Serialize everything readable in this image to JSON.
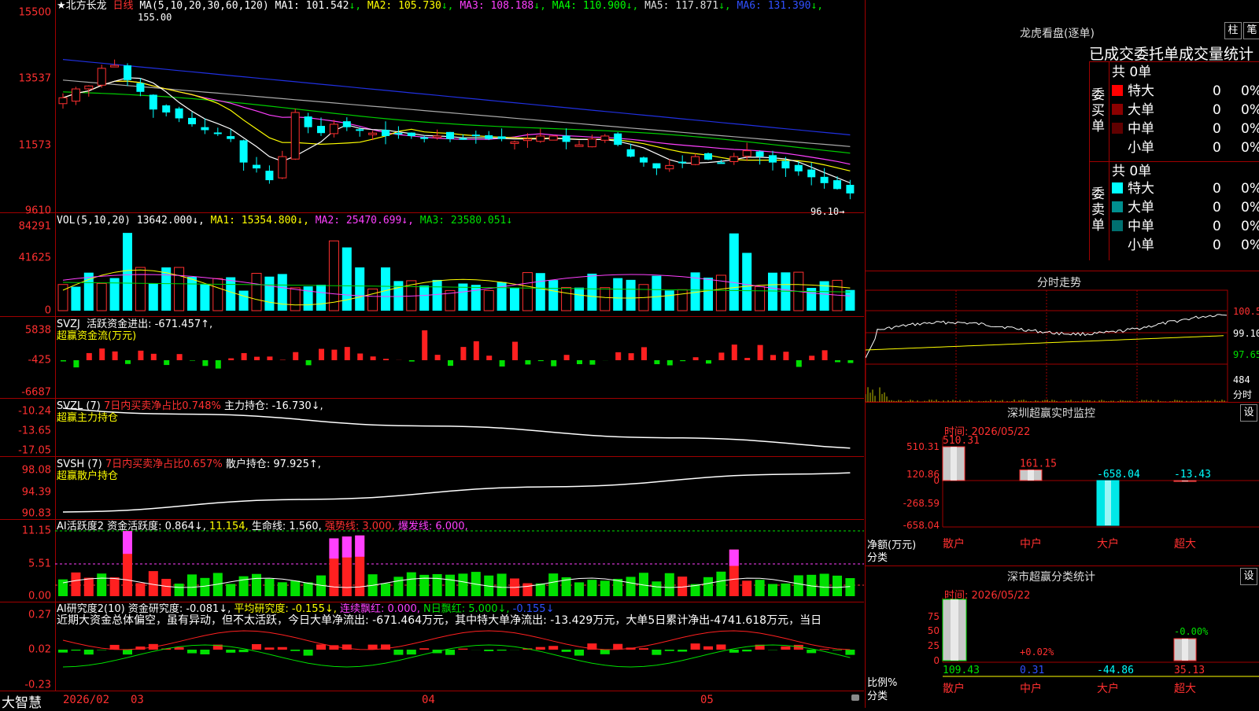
{
  "main": {
    "stock_name": "★北方长龙",
    "period": "日线",
    "ma_label": "MA(5,10,20,30,60,120)",
    "ma": [
      {
        "label": "MA1:",
        "value": "101.542",
        "arrow": "↓",
        "color": "#ffffff"
      },
      {
        "label": "MA2:",
        "value": "105.730",
        "arrow": "↓",
        "color": "#ffff00"
      },
      {
        "label": "MA3:",
        "value": "108.188",
        "arrow": "↓",
        "color": "#ff40ff"
      },
      {
        "label": "MA4:",
        "value": "110.900",
        "arrow": "↓",
        "color": "#00ff00"
      },
      {
        "label": "MA5:",
        "value": "117.871",
        "arrow": "↓",
        "color": "#dddddd"
      },
      {
        "label": "MA6:",
        "value": "131.390",
        "arrow": "↓",
        "color": "#3050ff"
      }
    ],
    "y_labels": [
      "15500",
      "13537",
      "11573",
      "9610"
    ],
    "high_mark": "155.00",
    "low_mark": "96.10→"
  },
  "vol": {
    "label": "VOL(5,10,20)",
    "value": "13642.000↓,",
    "ma1": "MA1: 15354.800↓,",
    "ma2": "MA2: 25470.699↓,",
    "ma3": "MA3: 23580.051↓",
    "y_labels": [
      "84291",
      "41625",
      "0"
    ]
  },
  "svzj": {
    "label": "SVZJ",
    "line": "活跃资金进出: -671.457↑,",
    "sub": "超赢资金流(万元)",
    "y_labels": [
      "5838",
      "-425",
      "-6687"
    ]
  },
  "svzl": {
    "label": "SVZL (7)",
    "t1": "7日内买卖净占比0.748%",
    "t2": "主力持仓: -16.730↓,",
    "sub": "超赢主力持仓",
    "y_labels": [
      "-10.24",
      "-13.65",
      "-17.05"
    ]
  },
  "svsh": {
    "label": "SVSH (7)",
    "t1": "7日内买卖净占比0.657%",
    "t2": "散户持仓: 97.925↑,",
    "sub": "超赢散户持仓",
    "y_labels": [
      "98.08",
      "94.39",
      "90.83"
    ]
  },
  "ai1": {
    "label": "AI活跃度2",
    "t1": "资金活跃度: 0.864↓,",
    "t2": "11.154,",
    "t3": "生命线: 1.560,",
    "t4": "强势线: 3.000,",
    "t5": "爆发线: 6.000,",
    "y_labels": [
      "11.15",
      "5.51",
      "0.00"
    ]
  },
  "ai2": {
    "label": "AI研究度2(10)",
    "t1": "资金研究度: -0.081↓,",
    "t2": "平均研究度: -0.155↓,",
    "t3": "连续飘红: 0.000,",
    "t4": "N日飘红: 5.000↓,",
    "t5": "-0.155↓",
    "desc": "近期大资金总体偏空，虽有异动，但不太活跃，今日大单净流出: -671.464万元，其中特大单净流出: -13.429万元，大单5日累计净出-4741.618万元，当日",
    "y_labels": [
      "0.27",
      "0.02",
      "-0.23"
    ]
  },
  "xaxis": {
    "brand": "大智慧",
    "labels": [
      "2026/02",
      "03",
      "04",
      "05"
    ]
  },
  "lhb": {
    "title": "龙虎看盘(逐单)",
    "btn1": "柱",
    "btn2": "笔",
    "header": "已成交委托单成交量统计",
    "buy_side": "委买单",
    "sell_side": "委卖单",
    "buy_total": "共 0单",
    "sell_total": "共 0单",
    "buy_rows": [
      {
        "name": "特大",
        "count": "0",
        "pct": "0%",
        "color": "#ff0000"
      },
      {
        "name": "大单",
        "count": "0",
        "pct": "0%",
        "color": "#8b0000"
      },
      {
        "name": "中单",
        "count": "0",
        "pct": "0%",
        "color": "#600000"
      },
      {
        "name": "小单",
        "count": "0",
        "pct": "0%",
        "color": "#000000"
      }
    ],
    "sell_rows": [
      {
        "name": "特大",
        "count": "0",
        "pct": "0%",
        "color": "#00ffff"
      },
      {
        "name": "大单",
        "count": "0",
        "pct": "0%",
        "color": "#009090"
      },
      {
        "name": "中单",
        "count": "0",
        "pct": "0%",
        "color": "#007070"
      },
      {
        "name": "小单",
        "count": "0",
        "pct": "0%",
        "color": "#000000"
      }
    ]
  },
  "intraday": {
    "title": "分时走势",
    "y_labels": [
      "100.5",
      "99.10",
      "97.65",
      "484"
    ],
    "vol_label": "分时"
  },
  "monitor": {
    "title": "深圳超赢实时监控",
    "btn": "设",
    "time": "时间: 2026/05/22",
    "y_labels": [
      "510.31",
      "120.86",
      "0",
      "-268.59",
      "-658.04"
    ],
    "values": [
      {
        "cat": "散户",
        "value": "510.31",
        "num": 510.31,
        "color": "#ff3030"
      },
      {
        "cat": "中户",
        "value": "161.15",
        "num": 161.15,
        "color": "#ff3030"
      },
      {
        "cat": "大户",
        "value": "-658.04",
        "num": -658.04,
        "color": "#00e000"
      },
      {
        "cat": "超大",
        "value": "-13.43",
        "num": -13.43,
        "color": "#00e000"
      }
    ],
    "y_title1": "净额(万元)",
    "y_title2": "分类"
  },
  "classify": {
    "title": "深市超赢分类统计",
    "btn": "设",
    "time": "时间: 2026/05/22",
    "y_labels": [
      "75",
      "50",
      "25",
      "0"
    ],
    "bars": [
      {
        "cat": "散户",
        "top": "",
        "bottom": "109.43",
        "color_top": "#ff3030",
        "color_bottom": "#00e000"
      },
      {
        "cat": "中户",
        "top": "+0.02%",
        "bottom": "0.31",
        "color_top": "#ff3030",
        "color_bottom": "#3050ff"
      },
      {
        "cat": "大户",
        "top": "",
        "bottom": "-44.86",
        "color_top": "#ff3030",
        "color_bottom": "#00ffff"
      },
      {
        "cat": "超大",
        "top": "-0.00%",
        "bottom": "35.13",
        "color_top": "#00e000",
        "color_bottom": "#ff3030"
      }
    ],
    "y_title1": "比例%",
    "y_title2": "分类"
  }
}
